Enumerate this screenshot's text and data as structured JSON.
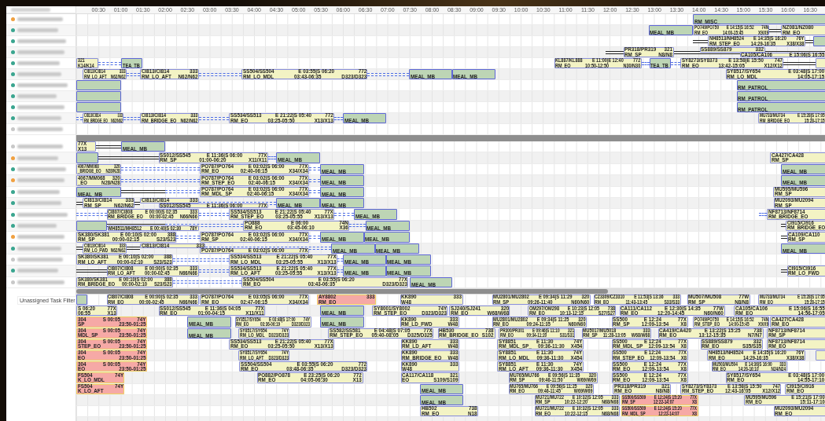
{
  "header": {
    "ticks": [
      "00:30",
      "01:00",
      "01:30",
      "02:00",
      "02:30",
      "03:00",
      "03:30",
      "04:00",
      "04:30",
      "05:00",
      "05:30",
      "06:00",
      "06:30",
      "07:00",
      "07:30",
      "08:00",
      "08:30",
      "09:00",
      "09:30",
      "10:00",
      "10:30",
      "11:00",
      "11:30",
      "12:00",
      "12:30",
      "13:00",
      "13:30",
      "14:00",
      "14:30",
      "15:00",
      "15:30",
      "16:00",
      "16:30"
    ]
  },
  "sections": [
    {
      "kind": "assigned",
      "rows": [
        {
          "color": "#f0a040",
          "links": [],
          "bars": [
            {
              "kind": "task",
              "label": "RM_MISC_"
            }
          ]
        },
        {
          "color": "#3aa58f",
          "links": [
            {
              "kind": "solid"
            }
          ],
          "bars": [
            {
              "kind": "task",
              "label": "MEAL_MB"
            },
            {
              "kind": "flight",
              "flight": "PO749/PO750",
              "schedule": "E 14:15|S 16:52",
              "aircraft": "74N",
              "duty": "RM_EO",
              "window": "14:00-15:45",
              "stand": "X9/X9"
            },
            {
              "kind": "flight",
              "flight": "NZ081/NZ080",
              "duty": "RM_EO"
            }
          ]
        },
        {
          "color": "#3aa58f",
          "links": [
            {
              "kind": "solid"
            },
            {
              "kind": "solid"
            }
          ],
          "bars": [
            {
              "kind": "flight",
              "flight": "NH8513/NH8524",
              "schedule": "E 14:35|S 16:20",
              "aircraft": "76Y",
              "duty": "RM_STEP_EO",
              "window": "14:29-16:35",
              "stand": "X38/X38"
            },
            {
              "kind": "task"
            }
          ]
        },
        {
          "color": "#3aa58f",
          "links": [
            {
              "kind": "solid"
            },
            {
              "kind": "solid"
            }
          ],
          "bars": [
            {
              "kind": "flight",
              "flight": "PR318/PR319",
              "aircraft": "321",
              "duty": "RM_SP",
              "stand": "N8/N8"
            },
            {
              "kind": "flight",
              "flight": "SS889/SS879",
              "aircraft": "332"
            },
            {
              "kind": "flight",
              "flight": "CA105/CA106",
              "schedule": "E 15:06|S 16:55"
            }
          ]
        },
        {
          "color": "#3aa58f",
          "links": [
            {
              "kind": "dashed"
            },
            {
              "kind": "dashed"
            },
            {
              "kind": "dashed"
            },
            {
              "kind": "solid"
            }
          ],
          "bars": [
            {
              "kind": "flight",
              "aircraft": "321",
              "stand": "K14/K14"
            },
            {
              "kind": "task",
              "label": "TEA_TB"
            },
            {
              "kind": "flight",
              "flight": "KL887/KL888",
              "schedule": "E 11:00|E 12:40",
              "aircraft": "772",
              "duty": "RM_EO",
              "window": "10:50-12:50",
              "stand": "N30/N30"
            },
            {
              "kind": "task",
              "label": "TEA_TB"
            },
            {
              "kind": "flight",
              "flight": "SY8273/SY8373",
              "schedule": "E 13:58|E 15:50",
              "aircraft": "747",
              "duty": "RM_EO",
              "window": "13:42-15:05",
              "stand": "X12/X12"
            },
            {
              "kind": "flight"
            }
          ]
        },
        {
          "color": "#3aa58f",
          "links": [
            {
              "kind": "dashed"
            },
            {
              "kind": "dashed"
            },
            {
              "kind": "dashed"
            }
          ],
          "bars": [
            {
              "kind": "flight",
              "flight": "CI813/CI814",
              "aircraft": "333",
              "duty": "RM_LO_AFT",
              "stand": "N62/N62"
            },
            {
              "kind": "flight",
              "flight": "CI813/CI814",
              "aircraft": "333",
              "duty": "RM_LO_AFT",
              "stand": "N62/N62"
            },
            {
              "kind": "flight",
              "flight": "SS504/SS504",
              "schedule": "E 03:55|S 06:20",
              "aircraft": "772",
              "duty": "RM_LO_MDL",
              "window": "03:43-06:35",
              "stand": "D323/D323"
            },
            {
              "kind": "task",
              "label": "MEAL_MB"
            },
            {
              "kind": "task",
              "label": "MEAL_MB"
            },
            {
              "kind": "flight",
              "flight": "SY8517/SY654",
              "schedule": "E 03:48|S 17:00",
              "duty": "RM_LO_MDL",
              "window": "14:05-17:15"
            }
          ]
        },
        {
          "color": "#3aa58f",
          "links": [],
          "bars": [
            {
              "kind": "task"
            },
            {
              "kind": "task",
              "label": "RM_PATROL_"
            }
          ]
        },
        {
          "color": "#3aa58f",
          "links": [],
          "bars": [
            {
              "kind": "task"
            },
            {
              "kind": "task",
              "label": "RM_PATROL_"
            }
          ]
        },
        {
          "color": "#3aa58f",
          "links": [],
          "bars": [
            {
              "kind": "task"
            },
            {
              "kind": "task",
              "label": "RM_PATROL_"
            }
          ]
        },
        {
          "color": "#3aa58f",
          "links": [
            {
              "kind": "dashed"
            },
            {
              "kind": "dashed"
            },
            {
              "kind": "dashed"
            },
            {
              "kind": "dashed"
            }
          ],
          "bars": [
            {
              "kind": "flight",
              "flight": "CI813/CI814",
              "aircraft": "333",
              "duty": "RM_BRIDGE_EO",
              "stand": "N62/N62"
            },
            {
              "kind": "flight",
              "flight": "CI813/CI814",
              "aircraft": "333",
              "duty": "RM_BRIDGE_EO",
              "stand": "N62/N62"
            },
            {
              "kind": "flight",
              "flight": "SS534/SS513",
              "schedule": "E 21:22|S 05:40",
              "aircraft": "772",
              "duty": "RM_EO",
              "window": "03:25-05:50",
              "stand": "X13/X13"
            },
            {
              "kind": "task",
              "label": "MEAL_MB"
            },
            {
              "kind": "flight",
              "flight": "MU733/MU734",
              "schedule": "E 15:28|S 17:05",
              "duty": "RM_BRIDGE_EO",
              "window": "15:28-17:15"
            }
          ]
        },
        {
          "color": "#c8c8c8",
          "links": [],
          "bars": []
        }
      ]
    },
    {
      "kind": "assigned",
      "rows": [
        {
          "color": "#c8c8c8",
          "links": [
            {
              "kind": "solid"
            }
          ],
          "bars": [
            {
              "kind": "flight",
              "aircraft": "77X",
              "stand": "X13"
            },
            {
              "kind": "task",
              "label": "MEAL_MB"
            }
          ]
        },
        {
          "color": "#f0a040",
          "links": [
            {
              "kind": "solid"
            },
            {
              "kind": "dashed"
            }
          ],
          "bars": [
            {
              "kind": "task"
            },
            {
              "kind": "flight",
              "flight": "SS012/SS545",
              "schedule": "E 11:36|S 06:00",
              "aircraft": "77X",
              "duty": "RM_SP",
              "window": "01:00-06:20",
              "stand": "X11/X11"
            },
            {
              "kind": "task",
              "label": "MEAL_MB"
            },
            {
              "kind": "flight",
              "flight": "CA427/CA428",
              "duty": "RM_SP"
            }
          ]
        },
        {
          "color": "#3aa58f",
          "links": [
            {
              "kind": "dashed"
            },
            {
              "kind": "dashed"
            }
          ],
          "bars": [
            {
              "kind": "flight",
              "flight": "4067/MM068",
              "aircraft": "320",
              "duty": "_BRIDGE_EO",
              "stand": "N28/N28"
            },
            {
              "kind": "flight",
              "flight": "PO787/PO764",
              "schedule": "E 03:02|S 06:00",
              "aircraft": "77X",
              "duty": "RM_EO",
              "window": "02:40-06:15",
              "stand": "X34/X34"
            },
            {
              "kind": "task",
              "label": "MEAL_MB"
            },
            {
              "kind": "task",
              "label": "MEAL_MB"
            }
          ]
        },
        {
          "color": "#f0a040",
          "links": [
            {
              "kind": "dashed"
            },
            {
              "kind": "dashed"
            }
          ],
          "bars": [
            {
              "kind": "flight",
              "flight": "4067/MM068",
              "aircraft": "320",
              "duty": "_EO",
              "stand": "N28/N28"
            },
            {
              "kind": "flight",
              "flight": "PO787/PO764",
              "schedule": "E 03:02|S 06:00",
              "aircraft": "77X",
              "duty": "RM_STEP_EO",
              "window": "02:40-06:15",
              "stand": "X34/X34"
            },
            {
              "kind": "task",
              "label": "MEAL_MB"
            },
            {
              "kind": "task",
              "label": "MEAL_MB"
            }
          ]
        },
        {
          "color": "#3aa58f",
          "links": [
            {
              "kind": "solid"
            },
            {
              "kind": "dashed"
            },
            {
              "kind": "dashed"
            }
          ],
          "bars": [
            {
              "kind": "task",
              "label": "MEAL_MB"
            },
            {
              "kind": "flight",
              "flight": "PO787/PO764",
              "schedule": "E 03:02|S 06:00",
              "aircraft": "77X",
              "duty": "RM_MDL_SP",
              "window": "02:40-06:15",
              "stand": "X34/X34"
            },
            {
              "kind": "task",
              "label": "MEAL_MB"
            },
            {
              "kind": "flight",
              "flight": "MU595/MU596",
              "duty": "RM_SP"
            }
          ]
        },
        {
          "color": "#3aa58f",
          "links": [
            {
              "kind": "solid"
            },
            {
              "kind": "solid"
            },
            {
              "kind": "dashed"
            }
          ],
          "bars": [
            {
              "kind": "flight",
              "flight": "CI813/CI814",
              "aircraft": "333",
              "duty": "RM_SP",
              "stand": "N62/N62"
            },
            {
              "kind": "flight",
              "flight": "CI813/CI814",
              "aircraft": "333"
            },
            {
              "kind": "flight",
              "flight": "SS012/SS545",
              "schedule": "E 11:36|S 06:00",
              "aircraft": "77X"
            },
            {
              "kind": "task",
              "label": "MEAL_MB"
            },
            {
              "kind": "task",
              "label": "MEAL_MB"
            },
            {
              "kind": "flight",
              "flight": "MU2093/MU2094",
              "duty": "RM_SP"
            }
          ]
        },
        {
          "color": "#3aa58f",
          "links": [
            {
              "kind": "dashed"
            },
            {
              "kind": "dashed"
            },
            {
              "kind": "dashed"
            },
            {
              "kind": "dashed"
            }
          ],
          "bars": [
            {
              "kind": "flight",
              "flight": "CI807/CI808",
              "schedule": "E 00:00|S 02:35",
              "aircraft": "333",
              "duty": "RM_BRIDGE_EO",
              "window": "00:00-02:45",
              "stand": "N66/N66"
            },
            {
              "kind": "flight",
              "flight": "SS534/SS513",
              "schedule": "E 21:22|S 05:40",
              "aircraft": "77X",
              "duty": "RM_STEP_EO",
              "window": "03:25-05:55",
              "stand": "X13/X13"
            },
            {
              "kind": "task",
              "label": "MEAL_MB"
            },
            {
              "kind": "flight",
              "flight": "NF8713/NF8714",
              "duty": "RM_BRIDGE_EO"
            }
          ]
        },
        {
          "color": "#3aa58f",
          "links": [
            {
              "kind": "solid"
            },
            {
              "kind": "dashed"
            },
            {
              "kind": "dashed"
            },
            {
              "kind": "solid"
            }
          ],
          "bars": [
            {
              "kind": "task"
            },
            {
              "kind": "flight",
              "flight": "MH8511/MH8512",
              "schedule": "E 00:40|S 02:30",
              "aircraft": "78Y"
            },
            {
              "kind": "flight",
              "flight": "PO888",
              "schedule": "E 06:00",
              "aircraft": "74N",
              "duty": "RM_EO",
              "window": "03:45-06:10",
              "stand": "X36"
            },
            {
              "kind": "task",
              "label": "MEAL_MB"
            },
            {
              "kind": "flight",
              "flight": "CI915/CI916",
              "duty": "RM_BRIDGE_EO"
            }
          ]
        },
        {
          "color": "#f0a040",
          "links": [
            {
              "kind": "dashed"
            },
            {
              "kind": "dashed"
            },
            {
              "kind": "solid"
            }
          ],
          "bars": [
            {
              "kind": "flight",
              "flight": "SK380/SK381",
              "schedule": "E 00:10|S 02:00",
              "aircraft": "388",
              "duty": "RM_SP",
              "window": "00:00-02:15",
              "stand": "S23/S23"
            },
            {
              "kind": "flight",
              "flight": "PO787/PO764",
              "schedule": "E 03:02|S 06:00",
              "aircraft": "77X",
              "duty": "RM_SP",
              "window": "02:40-06:15",
              "stand": "X34/X34"
            },
            {
              "kind": "task",
              "label": "MEAL_MB"
            },
            {
              "kind": "task",
              "label": "MEAL_MB"
            },
            {
              "kind": "flight",
              "flight": "CA109/CA110",
              "duty": "RM_SP"
            }
          ]
        },
        {
          "color": "#3aa58f",
          "links": [
            {
              "kind": "solid"
            },
            {
              "kind": "solid"
            },
            {
              "kind": "dashed"
            }
          ],
          "bars": [
            {
              "kind": "flight",
              "flight": "CI813/CI814",
              "aircraft": "333",
              "duty": "RM_LO_FWD",
              "stand": "N62/N62"
            },
            {
              "kind": "flight",
              "flight": "CI813/CI814",
              "aircraft": "333"
            },
            {
              "kind": "flight",
              "flight": "PO787/PO764",
              "schedule": "E 03:02|S 06:00",
              "aircraft": "77X"
            },
            {
              "kind": "task",
              "label": "MEAL_MB"
            },
            {
              "kind": "task",
              "label": "MEAL_MB"
            },
            {
              "kind": "task",
              "label": "MEAL_MB"
            }
          ]
        },
        {
          "color": "#c8c8c8",
          "links": [
            {
              "kind": "dashed"
            },
            {
              "kind": "dashed"
            }
          ],
          "bars": [
            {
              "kind": "flight",
              "flight": "SK380/SK381",
              "schedule": "E 00:10|S 02:00",
              "aircraft": "388",
              "duty": "RM_LO_AFT",
              "window": "00:00-02:10",
              "stand": "S23/S23"
            },
            {
              "kind": "flight",
              "flight": "SS534/SS513",
              "schedule": "E 21:22|S 05:40",
              "aircraft": "77X",
              "duty": "RM_LO_MDL",
              "window": "03:25-05:55",
              "stand": "X13/X13"
            },
            {
              "kind": "task",
              "label": "MEAL_MB"
            },
            {
              "kind": "task",
              "label": "MEAL_MB"
            }
          ]
        },
        {
          "color": "#3aa58f",
          "links": [
            {
              "kind": "solid"
            },
            {
              "kind": "dashed"
            },
            {
              "kind": "dashed"
            },
            {
              "kind": "solid"
            }
          ],
          "bars": [
            {
              "kind": "flight",
              "flight": "CI807/CI808",
              "schedule": "E 00:00|S 02:35",
              "aircraft": "333",
              "duty": "RM_LO_AFT",
              "window": "00:00-02:45",
              "stand": "N66/N66"
            },
            {
              "kind": "flight",
              "flight": "SS534/SS513",
              "schedule": "E 21:22|S 05:40",
              "aircraft": "77X",
              "duty": "RM_LO_AFT",
              "window": "03:25-05:55",
              "stand": "X13/X13"
            },
            {
              "kind": "task",
              "label": "MEAL_MB"
            },
            {
              "kind": "task",
              "label": "MEAL_MB"
            },
            {
              "kind": "flight",
              "flight": "CI915/CI916",
              "duty": "RM_LO_FWD"
            }
          ]
        },
        {
          "color": "#c8c8c8",
          "links": [
            {
              "kind": "dashed"
            }
          ],
          "bars": [
            {
              "kind": "flight",
              "flight": "SK380/SK381",
              "schedule": "E 00:10|S 02:00",
              "aircraft": "388",
              "duty": "RM_BRIDGE_EO",
              "window": "00:00-02:10",
              "stand": "S23/S23"
            },
            {
              "kind": "flight",
              "flight": "SS504/SS504",
              "schedule": "E 03:55|S 06:20",
              "aircraft": "77X",
              "duty": "RM_EO",
              "window": "03:43-06:35",
              "stand": "D323/D323"
            },
            {
              "kind": "task",
              "label": "MEAL_MB"
            }
          ]
        }
      ]
    },
    {
      "kind": "unassigned",
      "filter_label": "Unassigned Task Filter",
      "rows": [
        {
          "links": [],
          "bars": [
            {
              "kind": "task"
            },
            {
              "kind": "flight",
              "flight": "CI807/CI808",
              "schedule": "E 00:00|S 02:35",
              "aircraft": "333",
              "duty": "RM_EO",
              "window": "00:00-02:45",
              "stand": "N66/N66"
            },
            {
              "kind": "flight",
              "flight": "PO787/PO764",
              "schedule": "E 03:05|S 06:00",
              "aircraft": "77X",
              "duty": "RM_EO",
              "window": "02:47-06:15",
              "stand": "X34/X34"
            },
            {
              "kind": "alert",
              "flight": "AY8802",
              "aircraft": "333",
              "duty": "RM_EO"
            },
            {
              "kind": "flight",
              "flight": "KK890",
              "aircraft": "333",
              "stand": "W48"
            },
            {
              "kind": "flight",
              "flight": "MU2801/MU2802",
              "schedule": "E 09:34|S 11:29",
              "aircraft": "320",
              "duty": "RM_SP",
              "window": "09:26-11:40",
              "stand": "N60/N60"
            },
            {
              "kind": "flight",
              "flight": "CZ3309/CZ3310",
              "schedule": "E 11:53|S 13:36",
              "aircraft": "333",
              "duty": "RM_EO",
              "window": "11:43-13:45",
              "stand": "S33/S33"
            },
            {
              "kind": "flight",
              "flight": "MU507/MU508",
              "aircraft": "77W",
              "duty": "RM_SP",
              "stand": "N8/N8"
            },
            {
              "kind": "flight",
              "flight": "MU733/MU734",
              "schedule": "E 15:28|S 17:05",
              "duty": "RM_EO",
              "window": "15:28-17:15"
            }
          ]
        },
        {
          "links": [],
          "bars": [
            {
              "kind": "flight",
              "schedule": "S 06:20",
              "aircraft": "77X",
              "window": "06:55",
              "stand": "X13"
            },
            {
              "kind": "flight",
              "flight": "SS012/SS545",
              "schedule": "E 11:36|S 04:05",
              "aircraft": "77X",
              "duty": "RM_EO",
              "window": "01:00-04:15",
              "stand": "X11/X11"
            },
            {
              "kind": "task",
              "label": "MEAL_MB"
            },
            {
              "kind": "flight",
              "flight": "SY8001/SY8002",
              "aircraft": "74Y",
              "duty": "RM_STEP_EO",
              "stand": "D323/D323"
            },
            {
              "kind": "flight",
              "flight": "SJ240/SJ241",
              "aircraft": "320",
              "duty": "RM_EO",
              "stand": "W68/W68"
            },
            {
              "kind": "flight",
              "flight": "OM297/OM298",
              "schedule": "E 10:23|S 12:05",
              "aircraft": "738",
              "duty": "RM_EO",
              "window": "10:13-12:15",
              "stand": "S27/S27"
            },
            {
              "kind": "flight",
              "flight": "CA111/CA112",
              "schedule": "E 12:30|S 14:35",
              "aircraft": "77W",
              "duty": "RM_EO",
              "window": "12:20-14:45",
              "stand": "N60/N60"
            },
            {
              "kind": "flight",
              "flight": "CA105/CA106",
              "schedule": "E 15:06|S 16:55",
              "duty": "RM_EO",
              "window": "14:56-17:05"
            }
          ]
        },
        {
          "links": [],
          "bars": [
            {
              "kind": "alert",
              "flight": "304",
              "schedule": "S 00:05",
              "aircraft": "74Y",
              "duty": "SP",
              "window": "23:50-01:25"
            },
            {
              "kind": "task",
              "label": "MEAL_MB"
            },
            {
              "kind": "flight",
              "flight": "SY8517/SY654",
              "schedule": "E 03:48|S 17:00",
              "aircraft": "74Y",
              "duty": "RM_EO",
              "window": "03:36-06:19",
              "stand": "D323/D323"
            },
            {
              "kind": "task",
              "label": "MEAL_MB"
            },
            {
              "kind": "flight",
              "flight": "KK890",
              "aircraft": "333",
              "duty": "RM_LD_FWD",
              "stand": "W48"
            },
            {
              "kind": "flight",
              "flight": "MU2801/MU2802",
              "schedule": "E 09:34|S 11:25",
              "aircraft": "320",
              "duty": "RM_EO",
              "window": "09:24-11:35",
              "stand": "N60/N60"
            },
            {
              "kind": "flight",
              "flight": "SS500",
              "schedule": "E 12:24",
              "aircraft": "77X",
              "duty": "RM_SP",
              "window": "12:09-13:54",
              "stand": "X8"
            },
            {
              "kind": "flight",
              "flight": "PO749/PO750",
              "schedule": "E 14:15|S 16:52",
              "aircraft": "74N",
              "duty": "RM_STEP_EO",
              "window": "14:00-15:45",
              "stand": "X9/X9"
            },
            {
              "kind": "flight",
              "flight": "CA427/CA428",
              "duty": "RM_EO"
            }
          ]
        },
        {
          "links": [],
          "bars": [
            {
              "kind": "alert",
              "flight": "304",
              "schedule": "S 00:05",
              "aircraft": "74Y",
              "duty": "MDL_SP",
              "window": "23:50-01:25"
            },
            {
              "kind": "task",
              "label": "MEAL_MB"
            },
            {
              "kind": "flight",
              "flight": "SY8517/SY654",
              "aircraft": "74Y",
              "duty": "RM_LO_MDL",
              "stand": "D323/D323"
            },
            {
              "kind": "flight",
              "flight": "SS582/SS581",
              "schedule": "E 04:48|S 07:05",
              "aircraft": "77X",
              "duty": "RM_STEP_EO",
              "window": "05:40-08:05",
              "stand": "D325/D325"
            },
            {
              "kind": "flight",
              "flight": "HB530",
              "aircraft": "738",
              "duty": "RM_BRIDGE_EO",
              "stand": "S102"
            },
            {
              "kind": "flight",
              "flight": "PR300/PR301",
              "schedule": "E 09:46|S 11:10",
              "aircraft": "321",
              "duty": "RM_EO",
              "window": "09:34-11:20",
              "stand": "S31/S31"
            },
            {
              "kind": "flight",
              "flight": "MU5017/MU5018",
              "aircraft": "333",
              "duty": "RM_SP",
              "window": "11:28-13:05",
              "stand": "W68/W68"
            },
            {
              "kind": "flight",
              "flight": "CA419/CA420",
              "schedule": "E 13:22|S 15:25",
              "aircraft": "738",
              "duty": "RM_EO",
              "window": "13:12-15:35",
              "stand": "N7/N7"
            },
            {
              "kind": "flight",
              "flight": "NF8713/NF8714",
              "duty": "RM_SP"
            }
          ]
        },
        {
          "links": [],
          "bars": [
            {
              "kind": "alert",
              "flight": "304",
              "schedule": "S 00:05",
              "aircraft": "74Y",
              "duty": "STEP_EO",
              "window": "23:50-01:25"
            },
            {
              "kind": "flight",
              "flight": "SS534/SS513",
              "schedule": "E 21:22|S 05:40",
              "aircraft": "77X",
              "duty": "RM_EO",
              "window": "03:25-05:50",
              "stand": "X13/X13"
            },
            {
              "kind": "flight",
              "flight": "KK890",
              "aircraft": "333",
              "duty": "RM_LD_AFT",
              "stand": "W48"
            },
            {
              "kind": "flight",
              "flight": "SY8851",
              "schedule": "E 11:30",
              "aircraft": "74Y",
              "duty": "RM_MDL_SP_",
              "window": "09:36-11:30",
              "stand": "X454"
            },
            {
              "kind": "flight",
              "flight": "SS500",
              "schedule": "E 12:24",
              "aircraft": "77X",
              "duty": "RM_MDL_SP",
              "window": "12:09-13:54",
              "stand": "X8"
            },
            {
              "kind": "flight",
              "flight": "SS889/SS879",
              "aircraft": "332",
              "duty": "RM_EO",
              "stand": "S35/S35"
            },
            {
              "kind": "flight",
              "flight": "NF8713/NF8714",
              "duty": "RM_EO"
            }
          ]
        },
        {
          "links": [],
          "bars": [
            {
              "kind": "alert",
              "flight": "304",
              "schedule": "S 00:05",
              "aircraft": "74Y",
              "duty": "EO",
              "window": "23:50-01:25"
            },
            {
              "kind": "flight",
              "flight": "SY8517/SY654",
              "aircraft": "74Y",
              "duty": "RM_LO_AFT",
              "stand": "D323/D323"
            },
            {
              "kind": "flight",
              "flight": "KK890",
              "aircraft": "333",
              "duty": "RM_BRIDGE_EO",
              "stand": "W48"
            },
            {
              "kind": "flight",
              "flight": "SY8851",
              "schedule": "E 11:30",
              "aircraft": "74Y",
              "duty": "RM_LO_MDL",
              "window": "09:36-11:30",
              "stand": "X454"
            },
            {
              "kind": "flight",
              "flight": "SS500",
              "schedule": "E 12:24",
              "aircraft": "77X",
              "duty": "RM_STEP_EO",
              "window": "12:09-13:54",
              "stand": "X8"
            },
            {
              "kind": "flight",
              "flight": "NH8513/NH8524",
              "schedule": "E 14:35|S 16:20",
              "aircraft": "76Y",
              "duty": "RM_EO",
              "window": "14:29-16:35",
              "stand": "X38/X38"
            },
            {
              "kind": "flight"
            }
          ]
        },
        {
          "links": [],
          "bars": [
            {
              "kind": "alert",
              "flight": "304",
              "schedule": "S 00:05",
              "aircraft": "74Y",
              "duty": "EO",
              "window": "23:50-01:25"
            },
            {
              "kind": "flight",
              "flight": "SS504/SS504",
              "schedule": "E 03:55|S 06:20",
              "aircraft": "772",
              "duty": "RM_EO",
              "window": "03:48-06:35",
              "stand": "D323/D323"
            },
            {
              "kind": "flight",
              "flight": "KK890",
              "aircraft": "333",
              "stand": "W48"
            },
            {
              "kind": "flight",
              "flight": "SY8851",
              "schedule": "E 11:30",
              "aircraft": "74Y",
              "duty": "RM_LO_AFT",
              "window": "09:36-11:30",
              "stand": "X454"
            },
            {
              "kind": "flight",
              "flight": "SS500",
              "schedule": "E 12:24",
              "aircraft": "77X",
              "duty": "RM_EO",
              "window": "12:09-13:54",
              "stand": "X8"
            },
            {
              "kind": "flight",
              "flight": "MU503/MU504",
              "schedule": "E 14:36|S 16:00",
              "aircraft": "333",
              "duty": "RM_EO",
              "window": "14:26-16:10",
              "stand": "N24/N24"
            }
          ]
        },
        {
          "links": [],
          "bars": [
            {
              "kind": "alert",
              "flight": "FS504",
              "aircraft": "74Y",
              "duty": "K_LO_MDL"
            },
            {
              "kind": "flight",
              "flight": "PO882/PO878",
              "schedule": "E 23:25|S 06:20",
              "aircraft": "772",
              "duty": "RM_EO",
              "window": "04:05-06:30",
              "stand": "X13"
            },
            {
              "kind": "flight",
              "flight": "CA117/CA118",
              "aircraft": "321",
              "duty": "EO",
              "stand": "S109/S109"
            },
            {
              "kind": "flight",
              "flight": "MU765/MU766",
              "schedule": "E 09:56|S 11:35",
              "aircraft": "320",
              "duty": "RM_SP",
              "window": "09:46-11:50",
              "stand": "W69/W69"
            },
            {
              "kind": "flight",
              "flight": "SS500",
              "schedule": "E 12:24",
              "aircraft": "77X",
              "duty": "RM_EO",
              "window": "12:09-13:54",
              "stand": "X8"
            },
            {
              "kind": "flight",
              "flight": "SY8517/SY654",
              "schedule": "E 03:48|S 17:00",
              "duty": "RM_EO",
              "window": "14:55-17:10"
            }
          ]
        },
        {
          "links": [],
          "bars": [
            {
              "kind": "alert",
              "flight": "FS504",
              "aircraft": "74Y",
              "duty": "K_LO_AFT"
            },
            {
              "kind": "task",
              "label": "MEAL_MB"
            },
            {
              "kind": "flight",
              "flight": "MU765/MU766",
              "schedule": "E 09:56|S 11:25",
              "aircraft": "320",
              "duty": "RM_EO",
              "window": "09:46-11:45",
              "stand": "W69/W69"
            },
            {
              "kind": "flight",
              "flight": "PR318/PR319",
              "aircraft": "321",
              "duty": "RM_EO",
              "stand": "N8/N8"
            },
            {
              "kind": "flight",
              "flight": "SY8273/SY8373",
              "schedule": "E 13:58|S 15:50",
              "aircraft": "747",
              "duty": "RM_STEP_EO",
              "window": "12:43-16:05",
              "stand": "X12/X12"
            },
            {
              "kind": "flight",
              "flight": "CI915/CI916",
              "duty": "RM_EO"
            }
          ]
        },
        {
          "links": [],
          "bars": [
            {
              "kind": "task",
              "label": "MEAL_MB"
            },
            {
              "kind": "flight",
              "flight": "MU721/MU722",
              "schedule": "E 10:32|S 12:05",
              "aircraft": "333",
              "duty": "RM_SP",
              "window": "10:22-12:20",
              "stand": "N68/N68"
            },
            {
              "kind": "alert",
              "flight": "SS500/SS509",
              "schedule": "E 12:24|S 15:20",
              "aircraft": "77X",
              "duty": "RM_SP",
              "window": "12:22-14:07",
              "stand": "X8"
            },
            {
              "kind": "flight",
              "flight": "MU595/MU596",
              "schedule": "E 15:21|S 17:00",
              "duty": "RM_EO",
              "window": "15:11-17:10"
            }
          ]
        },
        {
          "links": [],
          "bars": [
            {
              "kind": "flight",
              "flight": "HB502",
              "aircraft": "738",
              "duty": "RM_EO",
              "stand": "N18"
            },
            {
              "kind": "flight",
              "flight": "MU721/MU722",
              "schedule": "E 10:32|S 12:05",
              "aircraft": "333",
              "duty": "RM_EO",
              "window": "10:22-12:15",
              "stand": "N68/N68"
            },
            {
              "kind": "alert",
              "flight": "SS500/SS509",
              "schedule": "E 12:24|S 15:20",
              "aircraft": "77X",
              "duty": "RM_MDL_SP",
              "window": "12:22-14:07",
              "stand": "X8"
            },
            {
              "kind": "flight",
              "flight": "MU2093/MU2094",
              "duty": "RM_EO"
            }
          ]
        }
      ]
    }
  ]
}
